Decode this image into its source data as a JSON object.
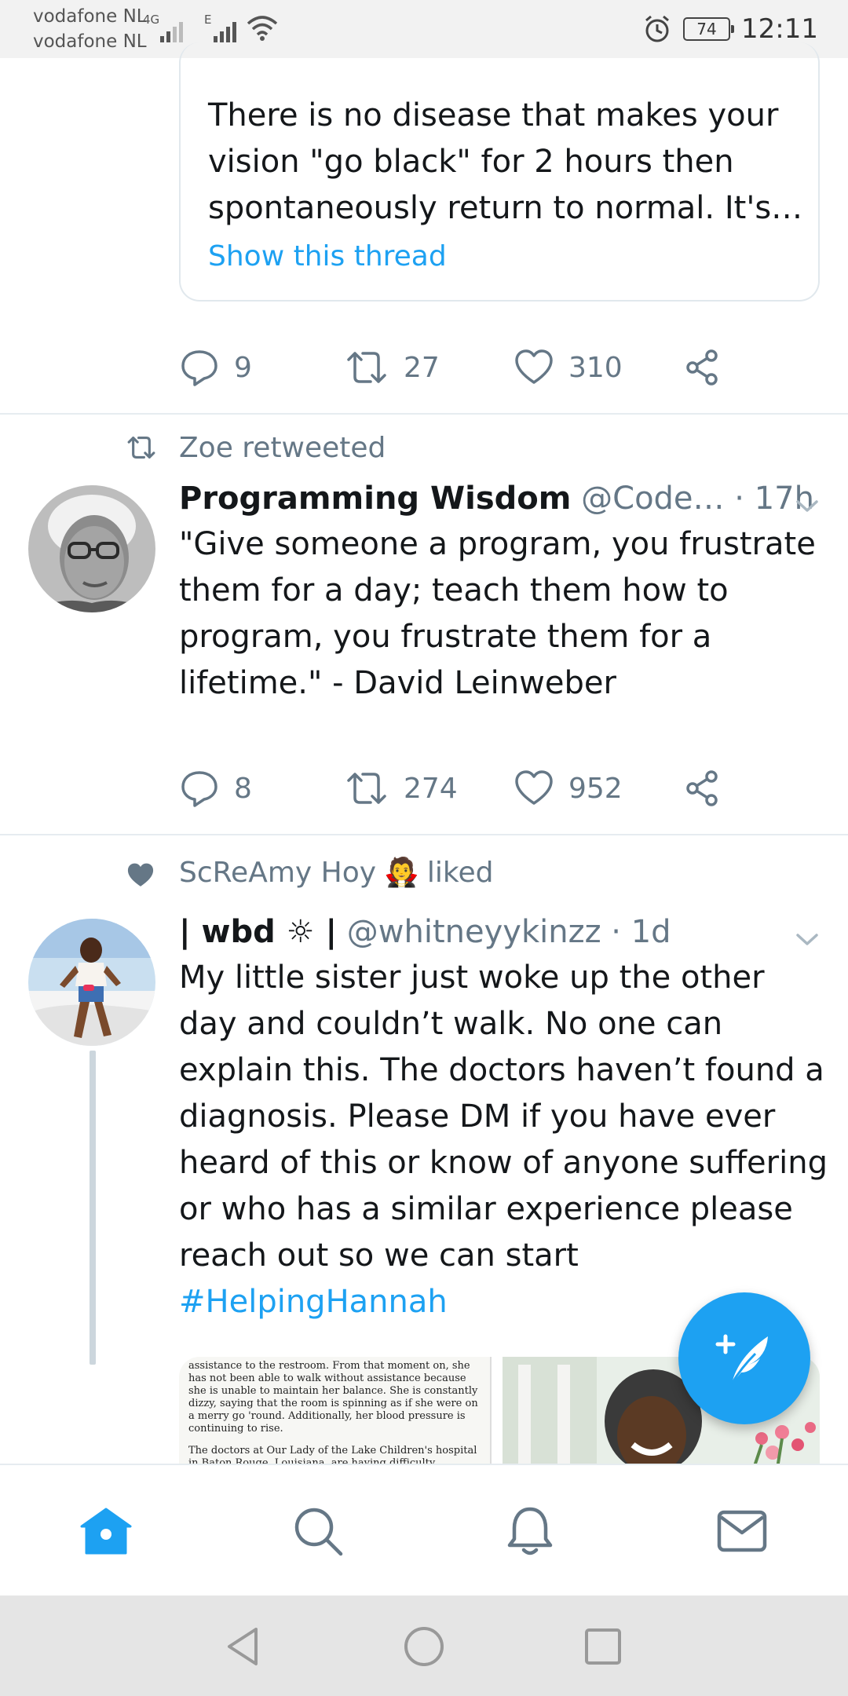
{
  "status_bar": {
    "carrier1": "vodafone NL",
    "carrier2": "vodafone NL",
    "network1": "4G",
    "network2": "E",
    "battery": "74",
    "time": "12:11"
  },
  "tweet0": {
    "quote_text": "There is no disease that makes your vision \"go black\" for 2 hours then spontaneously return to normal. It's…",
    "show_thread": "Show this thread",
    "replies": "9",
    "retweets": "27",
    "likes": "310"
  },
  "tweet1": {
    "social_context": "Zoe retweeted",
    "name": "Programming Wisdom",
    "meta": "@Code… · 17h",
    "text": "\"Give someone a program, you frustrate them for a day; teach them how to program, you frustrate them for a lifetime.\" - David Leinweber",
    "replies": "8",
    "retweets": "274",
    "likes": "952"
  },
  "tweet2": {
    "social_context_name": "ScReAmy Hoy",
    "social_context_emoji": "🧛",
    "social_context_action": "liked",
    "name": "| wbd ☼ |",
    "meta": "@whitneyykinzz · 1d",
    "text": "My little sister just woke up the other day and couldn’t walk. No one can explain this. The doctors haven’t found a diagnosis. Please DM if you have ever heard of this or know of anyone suffering or who has a similar experience please reach out so we can start",
    "hashtag": "#HelpingHannah",
    "media_text_1": "assistance to the restroom. From that moment on, she has not been able to walk without assistance because she is unable to maintain her balance. She is constantly dizzy, saying that the room is spinning as if she were on a merry go 'round. Additionally, her blood pressure is continuing to rise.",
    "media_text_2": "The doctors at Our Lady of the Lake Children's hospital in Baton Rouge, Louisiana, are having difficulty diagnosing her condition. They have conducted numerous tests, including body"
  },
  "icons": {
    "reply": "reply-icon",
    "retweet": "retweet-icon",
    "like": "heart-icon",
    "share": "share-icon",
    "compose": "compose-tweet-icon",
    "home": "home-icon",
    "search": "search-icon",
    "notifications": "bell-icon",
    "messages": "mail-icon"
  },
  "colors": {
    "accent": "#1da1f2",
    "muted": "#657786",
    "divider": "#e6ecf0"
  }
}
